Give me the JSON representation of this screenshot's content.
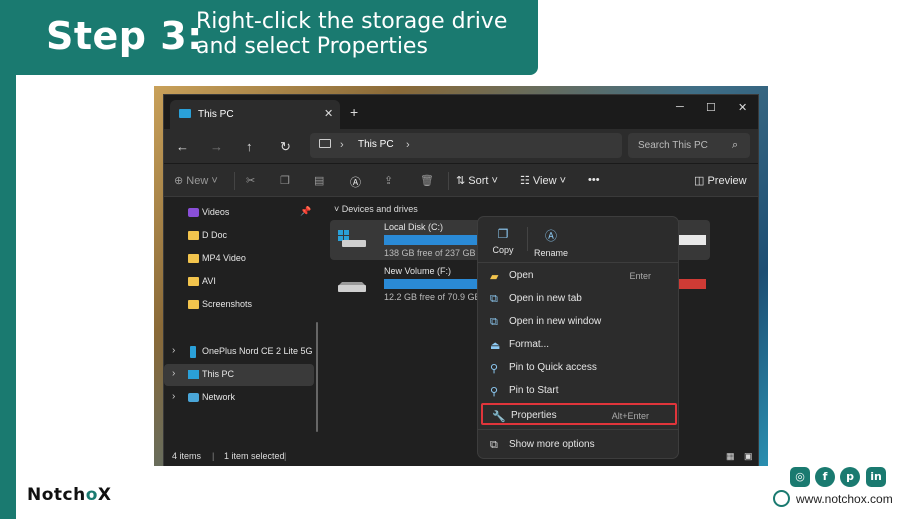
{
  "banner": {
    "step": "Step 3:",
    "line1": "Right-click the storage drive",
    "line2": "and select Properties"
  },
  "window": {
    "tab_title": "This PC",
    "address": {
      "crumb": "This PC"
    },
    "search_placeholder": "Search This PC",
    "toolbar": {
      "new_label": "New",
      "sort_label": "Sort",
      "view_label": "View",
      "preview_label": "Preview"
    },
    "sidebar": {
      "items": [
        {
          "label": "Videos"
        },
        {
          "label": "D Doc"
        },
        {
          "label": "MP4 Video"
        },
        {
          "label": "AVI"
        },
        {
          "label": "Screenshots"
        },
        {
          "label": "OnePlus Nord CE 2 Lite 5G"
        },
        {
          "label": "This PC"
        },
        {
          "label": "Network"
        }
      ]
    },
    "content": {
      "group": "Devices and drives",
      "drives": [
        {
          "name": "Local Disk (C:)",
          "size": "138 GB free of 237 GB",
          "used_fraction": 0.42
        },
        {
          "name": "New Volume (F:)",
          "size": "12.2 GB free of 70.9 GB",
          "used_fraction": 0.83
        }
      ]
    },
    "status": {
      "items": "4 items",
      "selected": "1 item selected"
    }
  },
  "context_menu": {
    "copy": "Copy",
    "rename": "Rename",
    "items": [
      {
        "label": "Open",
        "shortcut": "Enter"
      },
      {
        "label": "Open in new tab",
        "shortcut": ""
      },
      {
        "label": "Open in new window",
        "shortcut": ""
      },
      {
        "label": "Format...",
        "shortcut": ""
      },
      {
        "label": "Pin to Quick access",
        "shortcut": ""
      },
      {
        "label": "Pin to Start",
        "shortcut": ""
      },
      {
        "label": "Properties",
        "shortcut": "Alt+Enter"
      },
      {
        "label": "Show more options",
        "shortcut": ""
      }
    ]
  },
  "footer": {
    "website": "www.notchox.com"
  },
  "colors": {
    "brand": "#1a7a70",
    "highlight": "#e0353b",
    "drive_bar": "#2a8ad6"
  }
}
